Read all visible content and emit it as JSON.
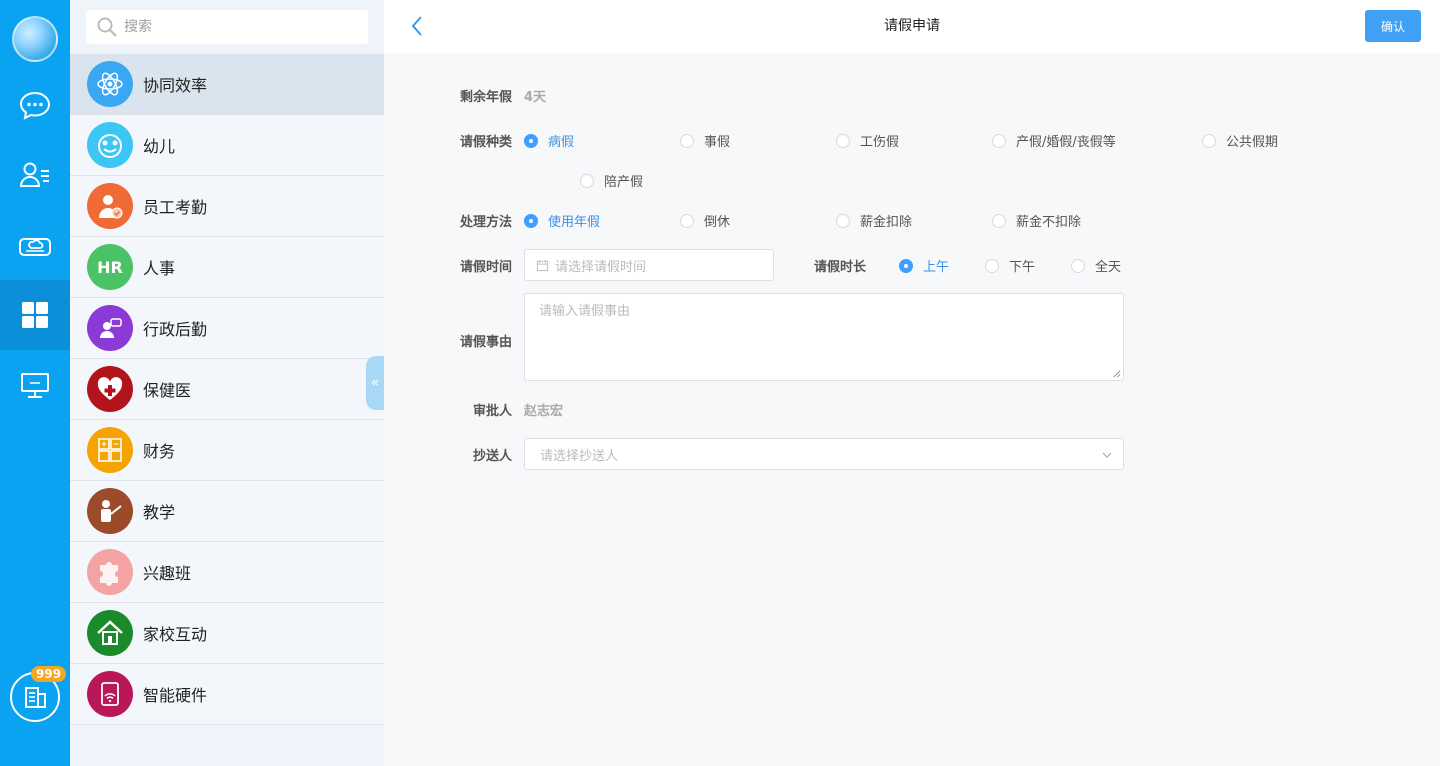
{
  "rail": {
    "items": [
      {
        "name": "chat-icon"
      },
      {
        "name": "contacts-icon"
      },
      {
        "name": "cloud-drive-icon"
      },
      {
        "name": "apps-grid-icon",
        "active": true
      },
      {
        "name": "desktop-icon"
      }
    ],
    "badge_count": "999"
  },
  "search": {
    "placeholder": "搜索"
  },
  "modules": [
    {
      "label": "协同效率",
      "color": "#3aa7f2",
      "icon": "atom-icon",
      "active": true
    },
    {
      "label": "幼儿",
      "color": "#3cc6f5",
      "icon": "child-face-icon"
    },
    {
      "label": "员工考勤",
      "color": "#f06a35",
      "icon": "attendance-icon"
    },
    {
      "label": "人事",
      "color": "#4cc266",
      "icon": "hr-icon"
    },
    {
      "label": "行政后勤",
      "color": "#8b3ad8",
      "icon": "admin-logistics-icon"
    },
    {
      "label": "保健医",
      "color": "#b3141c",
      "icon": "health-heart-icon"
    },
    {
      "label": "财务",
      "color": "#f5a300",
      "icon": "finance-icon"
    },
    {
      "label": "教学",
      "color": "#9b4b2a",
      "icon": "teaching-icon"
    },
    {
      "label": "兴趣班",
      "color": "#f4a3a3",
      "icon": "puzzle-icon"
    },
    {
      "label": "家校互动",
      "color": "#1a8a2a",
      "icon": "home-school-icon"
    },
    {
      "label": "智能硬件",
      "color": "#b8185a",
      "icon": "smart-hardware-icon"
    }
  ],
  "header": {
    "title": "请假申请",
    "confirm_label": "确认"
  },
  "form": {
    "annual_leave_label": "剩余年假",
    "annual_leave_value": "4天",
    "leave_type_label": "请假种类",
    "leave_types": [
      "病假",
      "事假",
      "工伤假",
      "产假/婚假/丧假等",
      "公共假期",
      "陪产假"
    ],
    "leave_type_selected": 0,
    "method_label": "处理方法",
    "methods": [
      "使用年假",
      "倒休",
      "薪金扣除",
      "薪金不扣除"
    ],
    "method_selected": 0,
    "time_label": "请假时间",
    "time_placeholder": "请选择请假时间",
    "duration_label": "请假时长",
    "durations": [
      "上午",
      "下午",
      "全天"
    ],
    "duration_selected": 0,
    "reason_label": "请假事由",
    "reason_placeholder": "请输入请假事由",
    "approver_label": "审批人",
    "approver_value": "赵志宏",
    "cc_label": "抄送人",
    "cc_placeholder": "请选择抄送人"
  }
}
